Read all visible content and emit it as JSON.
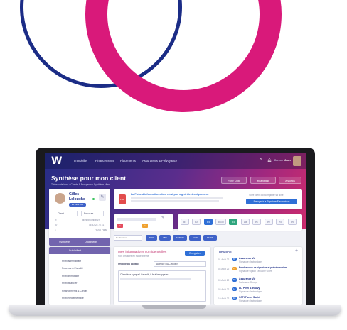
{
  "nav": {
    "logo": "W",
    "items": [
      "Immobilier",
      "Financements",
      "Placements",
      "Assurances & Prévoyance"
    ],
    "user_greeting": "Bonjour",
    "user_name": "Jean"
  },
  "header": {
    "title": "Synthèse pour mon client",
    "breadcrumb": "Tableau de bord › Clients & Prospects › Synthèse client",
    "actions": [
      "Fiche CRM",
      "eMarketing",
      "Analytics"
    ]
  },
  "client": {
    "first_name": "Gilles",
    "last_name": "Lelouche",
    "badge": "Ex. pend. reel",
    "type": "Client",
    "status": "En cours",
    "email": "gilles@company.fr",
    "phone": "06 82 28 70 41",
    "city": "75008 Paris",
    "tabs": [
      "Synthèse",
      "Documents"
    ]
  },
  "alert": {
    "title": "La Fiche d'information client n'est pas signé électroniquement",
    "body": "Votre client doit compléter sa fiche",
    "button": "Envoyer à la Signature Electronique"
  },
  "progress": {
    "steps": [
      "R1",
      "R2",
      "R3",
      "RECO",
      "R4",
      "LM",
      "P1",
      "P2",
      "P3",
      "R5"
    ]
  },
  "filter": {
    "search_placeholder": "Rechercher",
    "tags": [
      "PRO",
      "ABC",
      "ACTION",
      "SCPI",
      "PERIN"
    ]
  },
  "menu": {
    "header": "Suivi client",
    "items": [
      "Profil administratif",
      "Revenus & Fiscalité",
      "Profil immobilier",
      "Profil financier",
      "Financements & Crédits",
      "Profil Réglementaire"
    ]
  },
  "info": {
    "title": "Mes informations confidentielles",
    "subtitle": "Non diffusées en mode interne",
    "save": "Enregistrer",
    "origin_label": "Origine du contact",
    "origin_value": "Agence DUCHEMIN",
    "note": "Client très sympa ! Cela dit, il faut le rappeler"
  },
  "timeline": {
    "title": "Timeline",
    "events": [
      {
        "date": "01 Août 22",
        "title": "Assurance Vie",
        "sub": "Signature électronique"
      },
      {
        "date": "04 Août 22",
        "title": "Rendez-vous de signature et pré-réservation",
        "sub": "Signature Option Lelouche Gilles"
      },
      {
        "date": "05 Août 22",
        "title": "Assurance Vie",
        "sub": "Partenaire Groupe"
      },
      {
        "date": "05 Août 22",
        "title": "LLI Pinel & Innovy",
        "sub": "Signature électronique"
      },
      {
        "date": "10 Août 22",
        "title": "SCPI Parcel Santé",
        "sub": "Signature électronique"
      }
    ]
  },
  "colors": {
    "navy": "#1b2c86",
    "pink": "#d9197a",
    "accent": "#2f6fd6"
  }
}
